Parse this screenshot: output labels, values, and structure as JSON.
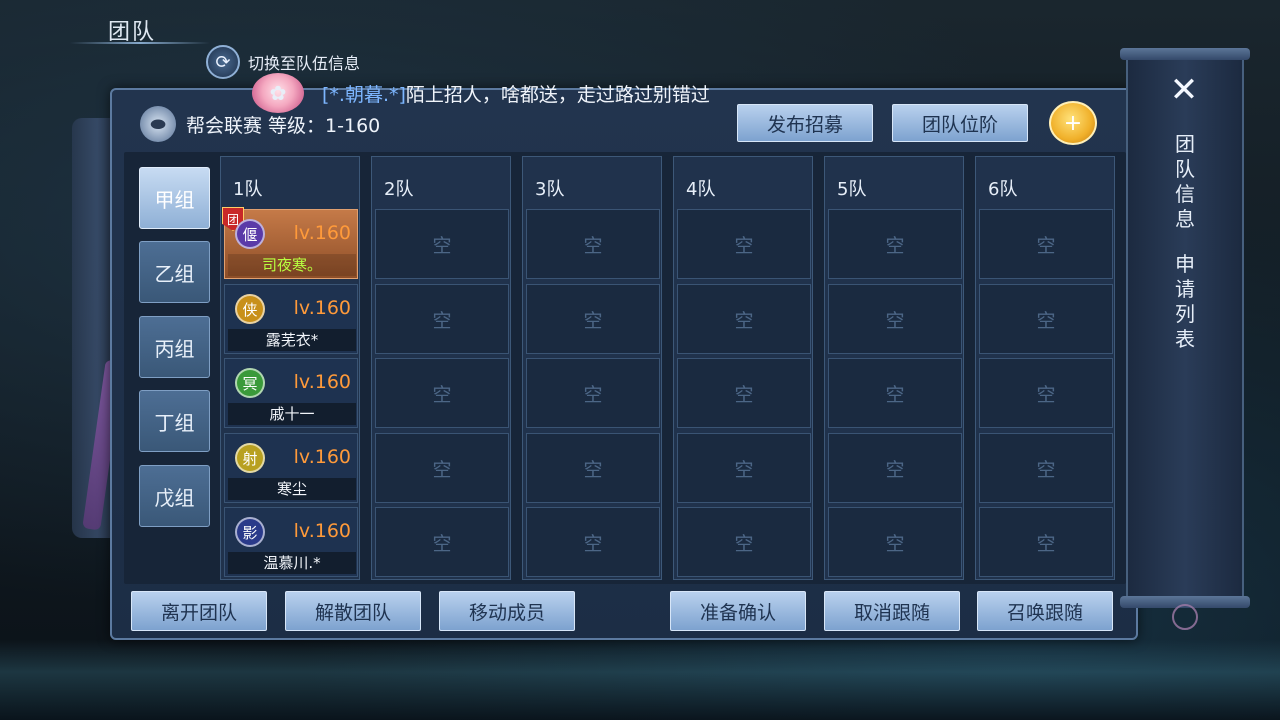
{
  "title": "团队",
  "switch_label": "切换至队伍信息",
  "announcement": {
    "name": "[*.朝暮.*]",
    "text": "陌上招人，啥都送，走过路过别错过"
  },
  "header": {
    "league_label": "帮会联赛  等级：1-160",
    "publish_button": "发布招募",
    "rank_button": "团队位阶"
  },
  "groups": [
    "甲组",
    "乙组",
    "丙组",
    "丁组",
    "戊组"
  ],
  "active_group": "甲组",
  "teams": [
    "1队",
    "2队",
    "3队",
    "4队",
    "5队",
    "6队"
  ],
  "empty_slot": "空",
  "members": [
    {
      "icon": "偃",
      "level": "lv.160",
      "name": "司夜寒。",
      "leader": true,
      "leader_badge": "团",
      "color": "#5a3aa8"
    },
    {
      "icon": "侠",
      "level": "lv.160",
      "name": "露芜衣*",
      "leader": false,
      "color": "#c8901a"
    },
    {
      "icon": "冥",
      "level": "lv.160",
      "name": "戚十一",
      "leader": false,
      "color": "#3a9a3a"
    },
    {
      "icon": "射",
      "level": "lv.160",
      "name": "寒尘",
      "leader": false,
      "color": "#b8a020"
    },
    {
      "icon": "影",
      "level": "lv.160",
      "name": "温慕川.*",
      "leader": false,
      "color": "#2a3a8a"
    }
  ],
  "bottom_buttons": {
    "leave": "离开团队",
    "disband": "解散团队",
    "move": "移动成员",
    "ready": "准备确认",
    "cancel_follow": "取消跟随",
    "summon_follow": "召唤跟随"
  },
  "side_tabs": {
    "team_info": "团队信息",
    "apply_list": "申请列表"
  },
  "close_icon": "close-icon",
  "icons": {
    "switch": "refresh-icon",
    "league": "pill-icon",
    "add": "add-user-icon"
  }
}
